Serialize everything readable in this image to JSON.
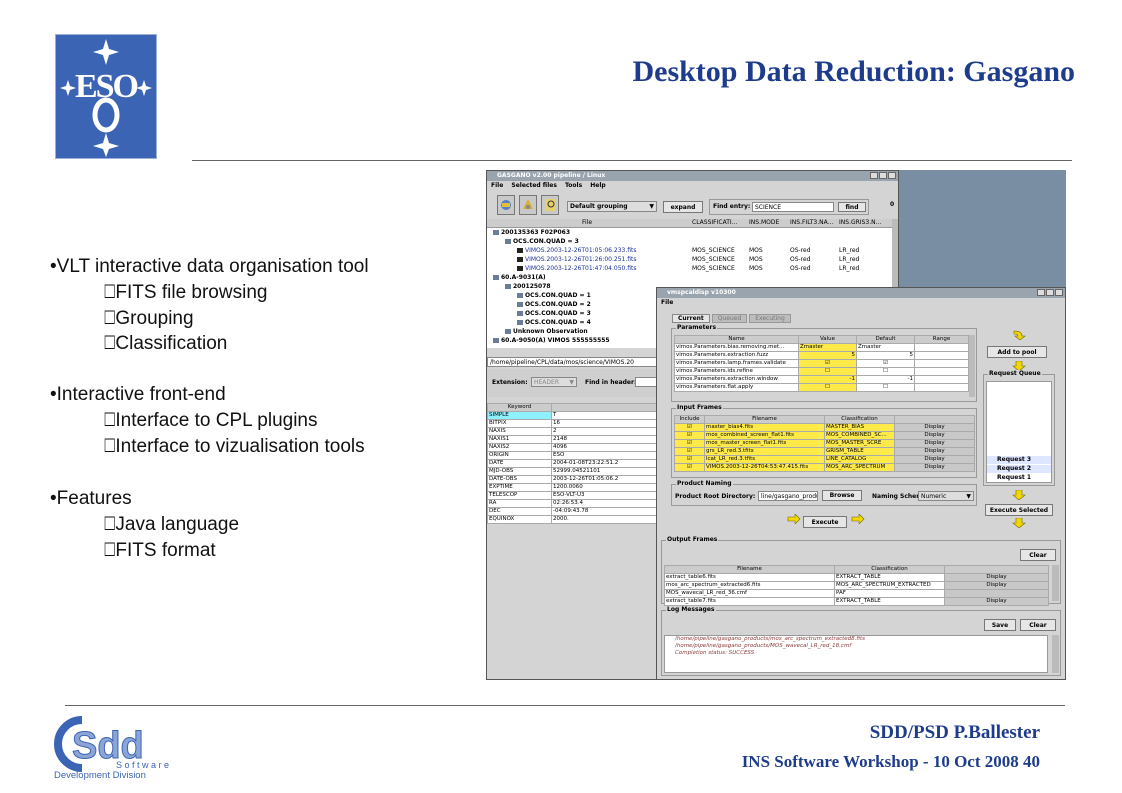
{
  "slide": {
    "title": "Desktop Data Reduction: Gasgano",
    "bullets": [
      {
        "text": "•VLT interactive data organisation tool",
        "subs": [
          "FITS file browsing",
          "Grouping",
          "Classification"
        ]
      },
      {
        "text": "•Interactive front-end",
        "subs": [
          "Interface to CPL plugins",
          "Interface to vizualisation tools"
        ]
      },
      {
        "text": "•Features",
        "subs": [
          "Java language",
          "FITS format"
        ]
      }
    ],
    "sub_marker": "⎕",
    "footer_author": "SDD/PSD P.Ballester",
    "footer_event": "INS Software Workshop -  10 Oct 2008  40"
  },
  "logos": {
    "eso": "ESO",
    "sdd_letters": "Sdd",
    "sdd_software": "S o f t w a r e",
    "sdd_division": "Development Division"
  },
  "colors": {
    "title": "#1e3c8c",
    "eso_blue": "#3c64b4",
    "highlight": "#ffea4a",
    "selection": "#8ff0ff"
  },
  "gasgano": {
    "title": "GASGANO v2.00 pipeline / Linux",
    "menu": [
      "File",
      "Selected files",
      "Tools",
      "Help"
    ],
    "grouping": "Default grouping",
    "expand": "expand",
    "find_label": "Find entry:",
    "find_value": "SCIENCE",
    "find_btn": "find",
    "counter": "0",
    "columns": [
      "File",
      "CLASSIFICATI...",
      "INS.MODE",
      "INS.FILT3.NA...",
      "INS.GRIS3.N..."
    ],
    "tree": [
      {
        "label": "200135363   F02P063",
        "indent": 0
      },
      {
        "label": "OCS.CON.QUAD = 3",
        "indent": 1
      },
      {
        "label": "VIMOS.2003-12-26T01:05:06.233.fits",
        "indent": 2,
        "file": true,
        "cols": [
          "MOS_SCIENCE",
          "MOS",
          "OS-red",
          "LR_red"
        ]
      },
      {
        "label": "VIMOS.2003-12-26T01:26:00.251.fits",
        "indent": 2,
        "file": true,
        "cols": [
          "MOS_SCIENCE",
          "MOS",
          "OS-red",
          "LR_red"
        ]
      },
      {
        "label": "VIMOS.2003-12-26T01:47:04.050.fits",
        "indent": 2,
        "file": true,
        "cols": [
          "MOS_SCIENCE",
          "MOS",
          "OS-red",
          "LR_red"
        ]
      },
      {
        "label": "60.A-9031(A)",
        "indent": 0
      },
      {
        "label": "200125078",
        "indent": 1
      },
      {
        "label": "OCS.CON.QUAD = 1",
        "indent": 2
      },
      {
        "label": "OCS.CON.QUAD = 2",
        "indent": 2
      },
      {
        "label": "OCS.CON.QUAD = 3",
        "indent": 2
      },
      {
        "label": "OCS.CON.QUAD = 4",
        "indent": 2
      },
      {
        "label": "Unknown Observation",
        "indent": 1
      },
      {
        "label": "60.A-9050(A)   VIMOS   555555555",
        "indent": 0
      }
    ],
    "path": "/home/pipeline/CPL/data/mos/science/VIMOS.20",
    "extension_label": "Extension:",
    "extension_value": "HEADER",
    "find_in_header": "Find in header:",
    "keyword_header": "Keyword",
    "header_rows": [
      [
        "SIMPLE",
        "T"
      ],
      [
        "BITPIX",
        "16"
      ],
      [
        "NAXIS",
        "2"
      ],
      [
        "NAXIS1",
        "2148"
      ],
      [
        "NAXIS2",
        "4096"
      ],
      [
        "ORIGIN",
        "ESO"
      ],
      [
        "DATE",
        "2004-01-08T23:22:51.2"
      ],
      [
        "MJD-OBS",
        "52999.04521101"
      ],
      [
        "DATE-OBS",
        "2003-12-26T01:05:06.2"
      ],
      [
        "EXPTIME",
        "1200.0060"
      ],
      [
        "TELESCOP",
        "ESO-VLT-U3"
      ],
      [
        "RA",
        "02:26:53.4"
      ],
      [
        "DEC",
        "-04:09:43.78"
      ],
      [
        "EQUINOX",
        "2000."
      ]
    ]
  },
  "recipe": {
    "title": "vmspcaldisp v10300",
    "menu": [
      "File"
    ],
    "tabs": [
      "Current",
      "Queued",
      "Executing"
    ],
    "params_title": "Parameters",
    "param_cols": [
      "Name",
      "Value",
      "Default",
      "Range"
    ],
    "params": [
      [
        "vimos.Parameters.bias.removing.met...",
        "Zmaster",
        "Zmaster",
        ""
      ],
      [
        "vimos.Parameters.extraction.fuzz",
        "5",
        "5",
        ""
      ],
      [
        "vimos.Parameters.lamp.frames.validate",
        "☑",
        "☑",
        ""
      ],
      [
        "vimos.Parameters.ids.refine",
        "☐",
        "☐",
        ""
      ],
      [
        "vimos.Parameters.extraction.window",
        "-1",
        "-1",
        ""
      ],
      [
        "vimos.Parameters.flat.apply",
        "☐",
        "☐",
        ""
      ]
    ],
    "input_title": "Input Frames",
    "input_cols": [
      "Include",
      "Filename",
      "Classification",
      ""
    ],
    "inputs": [
      [
        "master_bias4.fits",
        "MASTER_BIAS",
        "Display"
      ],
      [
        "mos_combined_screen_flat1.fits",
        "MOS_COMBINED_SC...",
        "Display"
      ],
      [
        "mos_master_screen_flat1.fits",
        "MOS_MASTER_SCRE",
        "Display"
      ],
      [
        "grs_LR_red.3.tfits",
        "GRISM_TABLE",
        "Display"
      ],
      [
        "lcat_LR_red.3.tfits",
        "LINE_CATALOG",
        "Display"
      ],
      [
        "VIMOS.2003-12-26T04:53:47.415.fits",
        "MOS_ARC_SPECTRUM",
        "Display"
      ]
    ],
    "naming_title": "Product Naming",
    "root_label": "Product Root Directory:",
    "root_value": "line/gasgano_product",
    "browse": "Browse",
    "naming_label": "Naming Scheme:",
    "naming_value": "Numeric",
    "execute": "Execute",
    "add_to_pool": "Add to pool",
    "queue_title": "Request Queue",
    "queue": [
      "Request 3",
      "Request 2",
      "Request 1"
    ],
    "execute_selected": "Execute Selected",
    "output_title": "Output Frames",
    "clear": "Clear",
    "output_cols": [
      "Filename",
      "Classification",
      ""
    ],
    "outputs": [
      [
        "extract_table6.fits",
        "EXTRACT_TABLE",
        "Display"
      ],
      [
        "mos_arc_spectrum_extracted6.fits",
        "MOS_ARC_SPECTRUM_EXTRACTED",
        "Display"
      ],
      [
        "MOS_wavecal_LR_red_36.cmf",
        "PAF",
        ""
      ],
      [
        "extract_table7.fits",
        "EXTRACT_TABLE",
        "Display"
      ]
    ],
    "log_title": "Log Messages",
    "save": "Save",
    "log": [
      "/home/pipeline/gasgano_products/mos_arc_spectrum_extracted8.fits",
      "/home/pipeline/gasgano_products/MOS_wavecal_LR_red_18.cmf",
      "Completion status: SUCCESS"
    ]
  }
}
